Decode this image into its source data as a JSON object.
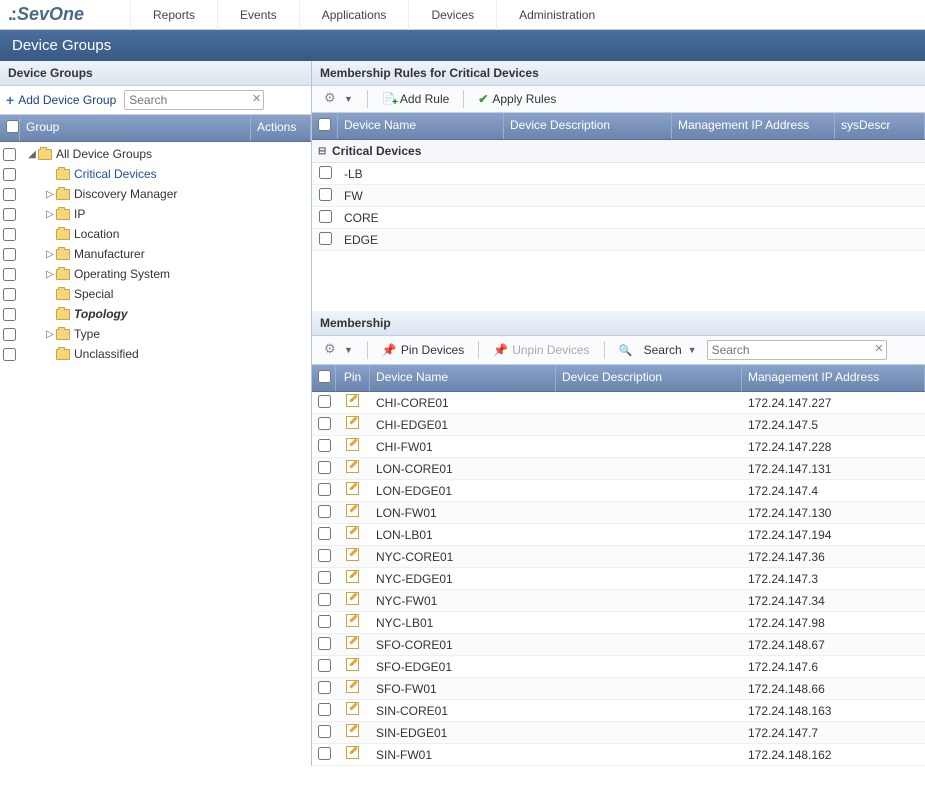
{
  "topnav": {
    "logo": "SevOne",
    "items": [
      "Reports",
      "Events",
      "Applications",
      "Devices",
      "Administration"
    ]
  },
  "page_title": "Device Groups",
  "left_panel": {
    "title": "Device Groups",
    "add_label": "Add Device Group",
    "search_placeholder": "Search",
    "header_group": "Group",
    "header_actions": "Actions",
    "tree": [
      {
        "label": "All Device Groups",
        "depth": 0,
        "expand": "open",
        "selected": false
      },
      {
        "label": "Critical Devices",
        "depth": 1,
        "expand": "none",
        "selected": true
      },
      {
        "label": "Discovery Manager",
        "depth": 1,
        "expand": "closed",
        "selected": false
      },
      {
        "label": "IP",
        "depth": 1,
        "expand": "closed",
        "selected": false
      },
      {
        "label": "Location",
        "depth": 1,
        "expand": "none",
        "selected": false
      },
      {
        "label": "Manufacturer",
        "depth": 1,
        "expand": "closed",
        "selected": false
      },
      {
        "label": "Operating System",
        "depth": 1,
        "expand": "closed",
        "selected": false
      },
      {
        "label": "Special",
        "depth": 1,
        "expand": "none",
        "selected": false
      },
      {
        "label": "Topology",
        "depth": 1,
        "expand": "none",
        "selected": false,
        "bold": true
      },
      {
        "label": "Type",
        "depth": 1,
        "expand": "closed",
        "selected": false
      },
      {
        "label": "Unclassified",
        "depth": 1,
        "expand": "none",
        "selected": false
      }
    ]
  },
  "rules_panel": {
    "title": "Membership Rules for Critical Devices",
    "btn_add_rule": "Add Rule",
    "btn_apply": "Apply Rules",
    "columns": {
      "name": "Device Name",
      "desc": "Device Description",
      "ip": "Management IP Address",
      "sys": "sysDescr"
    },
    "group_label": "Critical Devices",
    "rows": [
      {
        "name": "-LB",
        "desc": "",
        "ip": "",
        "sys": ""
      },
      {
        "name": "FW",
        "desc": "",
        "ip": "",
        "sys": ""
      },
      {
        "name": "CORE",
        "desc": "",
        "ip": "",
        "sys": ""
      },
      {
        "name": "EDGE",
        "desc": "",
        "ip": "",
        "sys": ""
      }
    ]
  },
  "membership_panel": {
    "title": "Membership",
    "btn_pin": "Pin Devices",
    "btn_unpin": "Unpin Devices",
    "btn_search": "Search",
    "search_placeholder": "Search",
    "columns": {
      "pin": "Pin",
      "name": "Device Name",
      "desc": "Device Description",
      "ip": "Management IP Address"
    },
    "rows": [
      {
        "name": "CHI-CORE01",
        "desc": "",
        "ip": "172.24.147.227"
      },
      {
        "name": "CHI-EDGE01",
        "desc": "",
        "ip": "172.24.147.5"
      },
      {
        "name": "CHI-FW01",
        "desc": "",
        "ip": "172.24.147.228"
      },
      {
        "name": "LON-CORE01",
        "desc": "",
        "ip": "172.24.147.131"
      },
      {
        "name": "LON-EDGE01",
        "desc": "",
        "ip": "172.24.147.4"
      },
      {
        "name": "LON-FW01",
        "desc": "",
        "ip": "172.24.147.130"
      },
      {
        "name": "LON-LB01",
        "desc": "",
        "ip": "172.24.147.194"
      },
      {
        "name": "NYC-CORE01",
        "desc": "",
        "ip": "172.24.147.36"
      },
      {
        "name": "NYC-EDGE01",
        "desc": "",
        "ip": "172.24.147.3"
      },
      {
        "name": "NYC-FW01",
        "desc": "",
        "ip": "172.24.147.34"
      },
      {
        "name": "NYC-LB01",
        "desc": "",
        "ip": "172.24.147.98"
      },
      {
        "name": "SFO-CORE01",
        "desc": "",
        "ip": "172.24.148.67"
      },
      {
        "name": "SFO-EDGE01",
        "desc": "",
        "ip": "172.24.147.6"
      },
      {
        "name": "SFO-FW01",
        "desc": "",
        "ip": "172.24.148.66"
      },
      {
        "name": "SIN-CORE01",
        "desc": "",
        "ip": "172.24.148.163"
      },
      {
        "name": "SIN-EDGE01",
        "desc": "",
        "ip": "172.24.147.7"
      },
      {
        "name": "SIN-FW01",
        "desc": "",
        "ip": "172.24.148.162"
      }
    ]
  }
}
